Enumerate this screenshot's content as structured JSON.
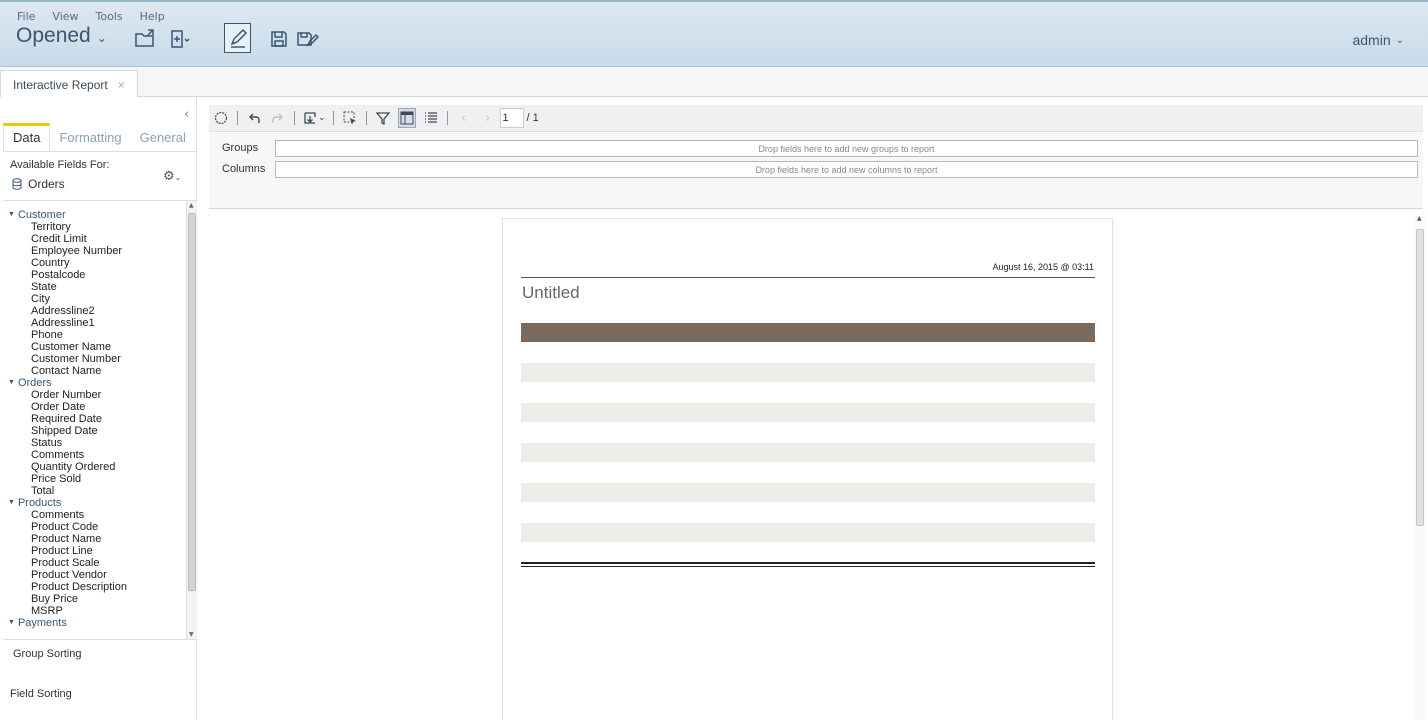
{
  "menu": [
    "File",
    "View",
    "Tools",
    "Help"
  ],
  "header": {
    "perspective": "Opened",
    "user": "admin"
  },
  "tabs": [
    {
      "label": "Interactive Report"
    }
  ],
  "left_panel": {
    "tabs": [
      "Data",
      "Formatting",
      "General"
    ],
    "active_tab": "Data",
    "available_label": "Available Fields For:",
    "datasource": "Orders",
    "categories": [
      {
        "name": "Customer",
        "fields": [
          "Territory",
          "Credit Limit",
          "Employee Number",
          "Country",
          "Postalcode",
          "State",
          "City",
          "Addressline2",
          "Addressline1",
          "Phone",
          "Customer Name",
          "Customer Number",
          "Contact Name"
        ]
      },
      {
        "name": "Orders",
        "fields": [
          "Order Number",
          "Order Date",
          "Required Date",
          "Shipped Date",
          "Status",
          "Comments",
          "Quantity Ordered",
          "Price Sold",
          "Total"
        ]
      },
      {
        "name": "Products",
        "fields": [
          "Comments",
          "Product Code",
          "Product Name",
          "Product Line",
          "Product Scale",
          "Product Vendor",
          "Product Description",
          "Buy Price",
          "MSRP"
        ]
      },
      {
        "name": "Payments",
        "fields": []
      }
    ],
    "group_sorting": "Group Sorting",
    "field_sorting": "Field Sorting"
  },
  "toolbar": {
    "page_current": "1",
    "page_total": "/ 1"
  },
  "dropzones": {
    "groups_label": "Groups",
    "groups_hint": "Drop fields here to add new groups to report",
    "columns_label": "Columns",
    "columns_hint": "Drop fields here to add new columns to report"
  },
  "report": {
    "date": "August 16, 2015 @ 03:11",
    "title": "Untitled",
    "header_band_color": "#7a6a5c",
    "row_band_color": "#eeeee8"
  },
  "colors": {
    "accent": "#f5c400",
    "header_text": "#3a5771"
  }
}
